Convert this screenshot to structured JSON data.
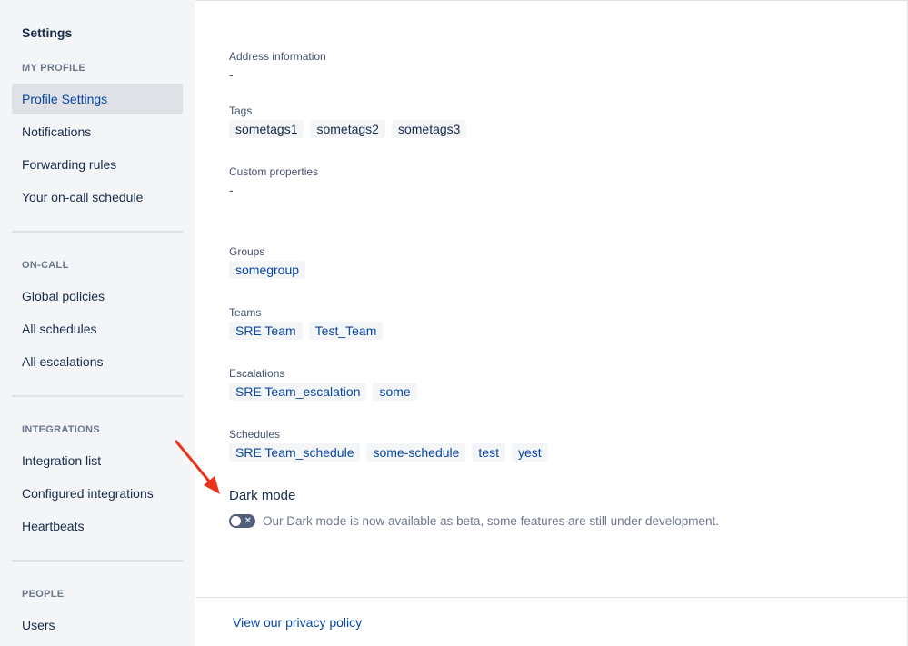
{
  "sidebar": {
    "title": "Settings",
    "sections": [
      {
        "heading": "MY PROFILE",
        "items": [
          "Profile Settings",
          "Notifications",
          "Forwarding rules",
          "Your on-call schedule"
        ],
        "active": "Profile Settings"
      },
      {
        "heading": "ON-CALL",
        "items": [
          "Global policies",
          "All schedules",
          "All escalations"
        ]
      },
      {
        "heading": "INTEGRATIONS",
        "items": [
          "Integration list",
          "Configured integrations",
          "Heartbeats"
        ]
      },
      {
        "heading": "PEOPLE",
        "items": [
          "Users"
        ]
      }
    ]
  },
  "profile": {
    "address": {
      "label": "Address information",
      "value": "-"
    },
    "tags": {
      "label": "Tags",
      "values": [
        "sometags1",
        "sometags2",
        "sometags3"
      ]
    },
    "custom_properties": {
      "label": "Custom properties",
      "value": "-"
    },
    "groups": {
      "label": "Groups",
      "values": [
        "somegroup"
      ]
    },
    "teams": {
      "label": "Teams",
      "values": [
        "SRE Team",
        "Test_Team"
      ]
    },
    "escalations": {
      "label": "Escalations",
      "values": [
        "SRE Team_escalation",
        "some"
      ]
    },
    "schedules": {
      "label": "Schedules",
      "values": [
        "SRE Team_schedule",
        "some-schedule",
        "test",
        "yest"
      ]
    },
    "dark_mode": {
      "title": "Dark mode",
      "description": "Our Dark mode is now available as beta, some features are still under development.",
      "enabled": false
    }
  },
  "footer": {
    "privacy_link": "View our privacy policy"
  },
  "colors": {
    "sidebar_bg": "#f4f5f7",
    "active_bg": "#dfe1e6",
    "link": "#0747a6",
    "annotation_arrow": "#e8331d"
  }
}
